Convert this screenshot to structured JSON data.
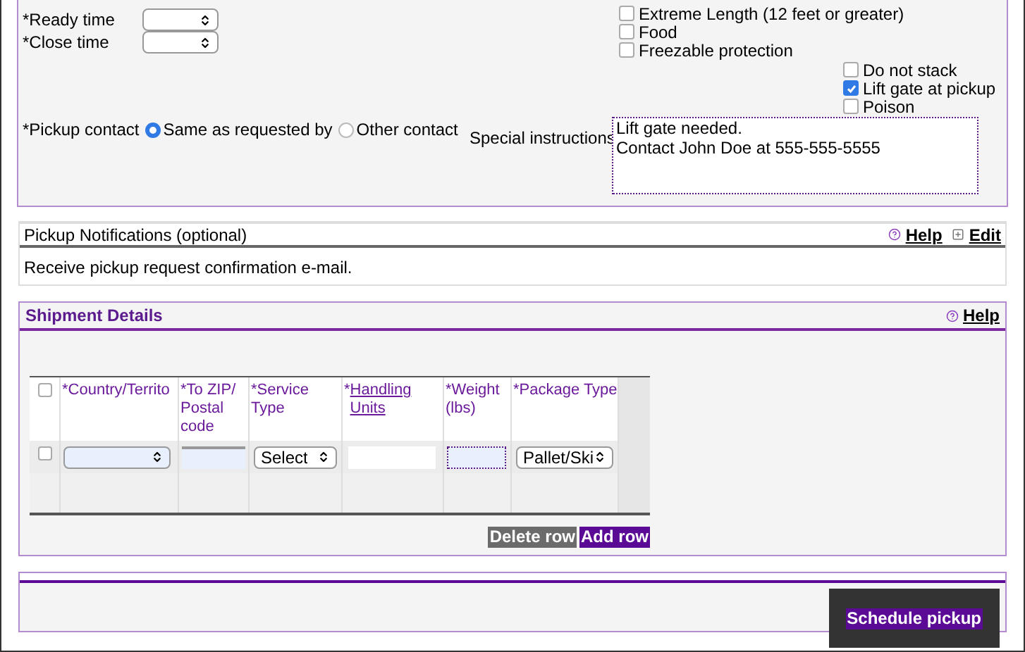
{
  "pickup_form": {
    "times": [
      {
        "label": "*Ready time"
      },
      {
        "label": "*Close time"
      }
    ],
    "special_services": [
      {
        "label": "Extreme Length (12 feet or greater)",
        "checked": false
      },
      {
        "label": "Food",
        "checked": false
      },
      {
        "label": "Freezable protection",
        "checked": false
      }
    ],
    "special_services_more": [
      {
        "label": "Do not stack",
        "checked": false
      },
      {
        "label": "Lift gate at pickup",
        "checked": true
      },
      {
        "label": "Poison",
        "checked": false
      }
    ],
    "pickup_contact": {
      "label": "*Pickup contact",
      "options": [
        {
          "label": "Same as requested by",
          "selected": true
        },
        {
          "label": "Other contact",
          "selected": false
        }
      ]
    },
    "special_instructions": {
      "label": "Special instructions",
      "value": "Lift gate needed.\nContact John Doe at 555-555-5555"
    }
  },
  "notifications": {
    "title": "Pickup Notifications (optional)",
    "help": "Help",
    "edit": "Edit",
    "text": "Receive pickup request confirmation e-mail."
  },
  "shipment_details": {
    "title": "Shipment Details",
    "help": "Help",
    "columns": [
      {
        "prefix": "*",
        "label": "Country/Territo",
        "kind": "text"
      },
      {
        "prefix": "*",
        "label": "To ZIP/ Postal code",
        "kind": "text"
      },
      {
        "prefix": "*",
        "label": "Service Type",
        "kind": "text"
      },
      {
        "prefix": "*",
        "label": "Handling Units",
        "kind": "link"
      },
      {
        "prefix": "*",
        "label": "Weight (lbs)",
        "kind": "text"
      },
      {
        "prefix": "*",
        "label": "Package Type",
        "kind": "text"
      }
    ],
    "header_checked": false,
    "row": {
      "checked": false,
      "service_type": "Select",
      "package_type": "Pallet/Ski"
    },
    "buttons": [
      {
        "label": "Delete row",
        "kind": "secondary"
      },
      {
        "label": "Add row",
        "kind": "primary"
      }
    ]
  },
  "schedule_button": "Schedule pickup"
}
